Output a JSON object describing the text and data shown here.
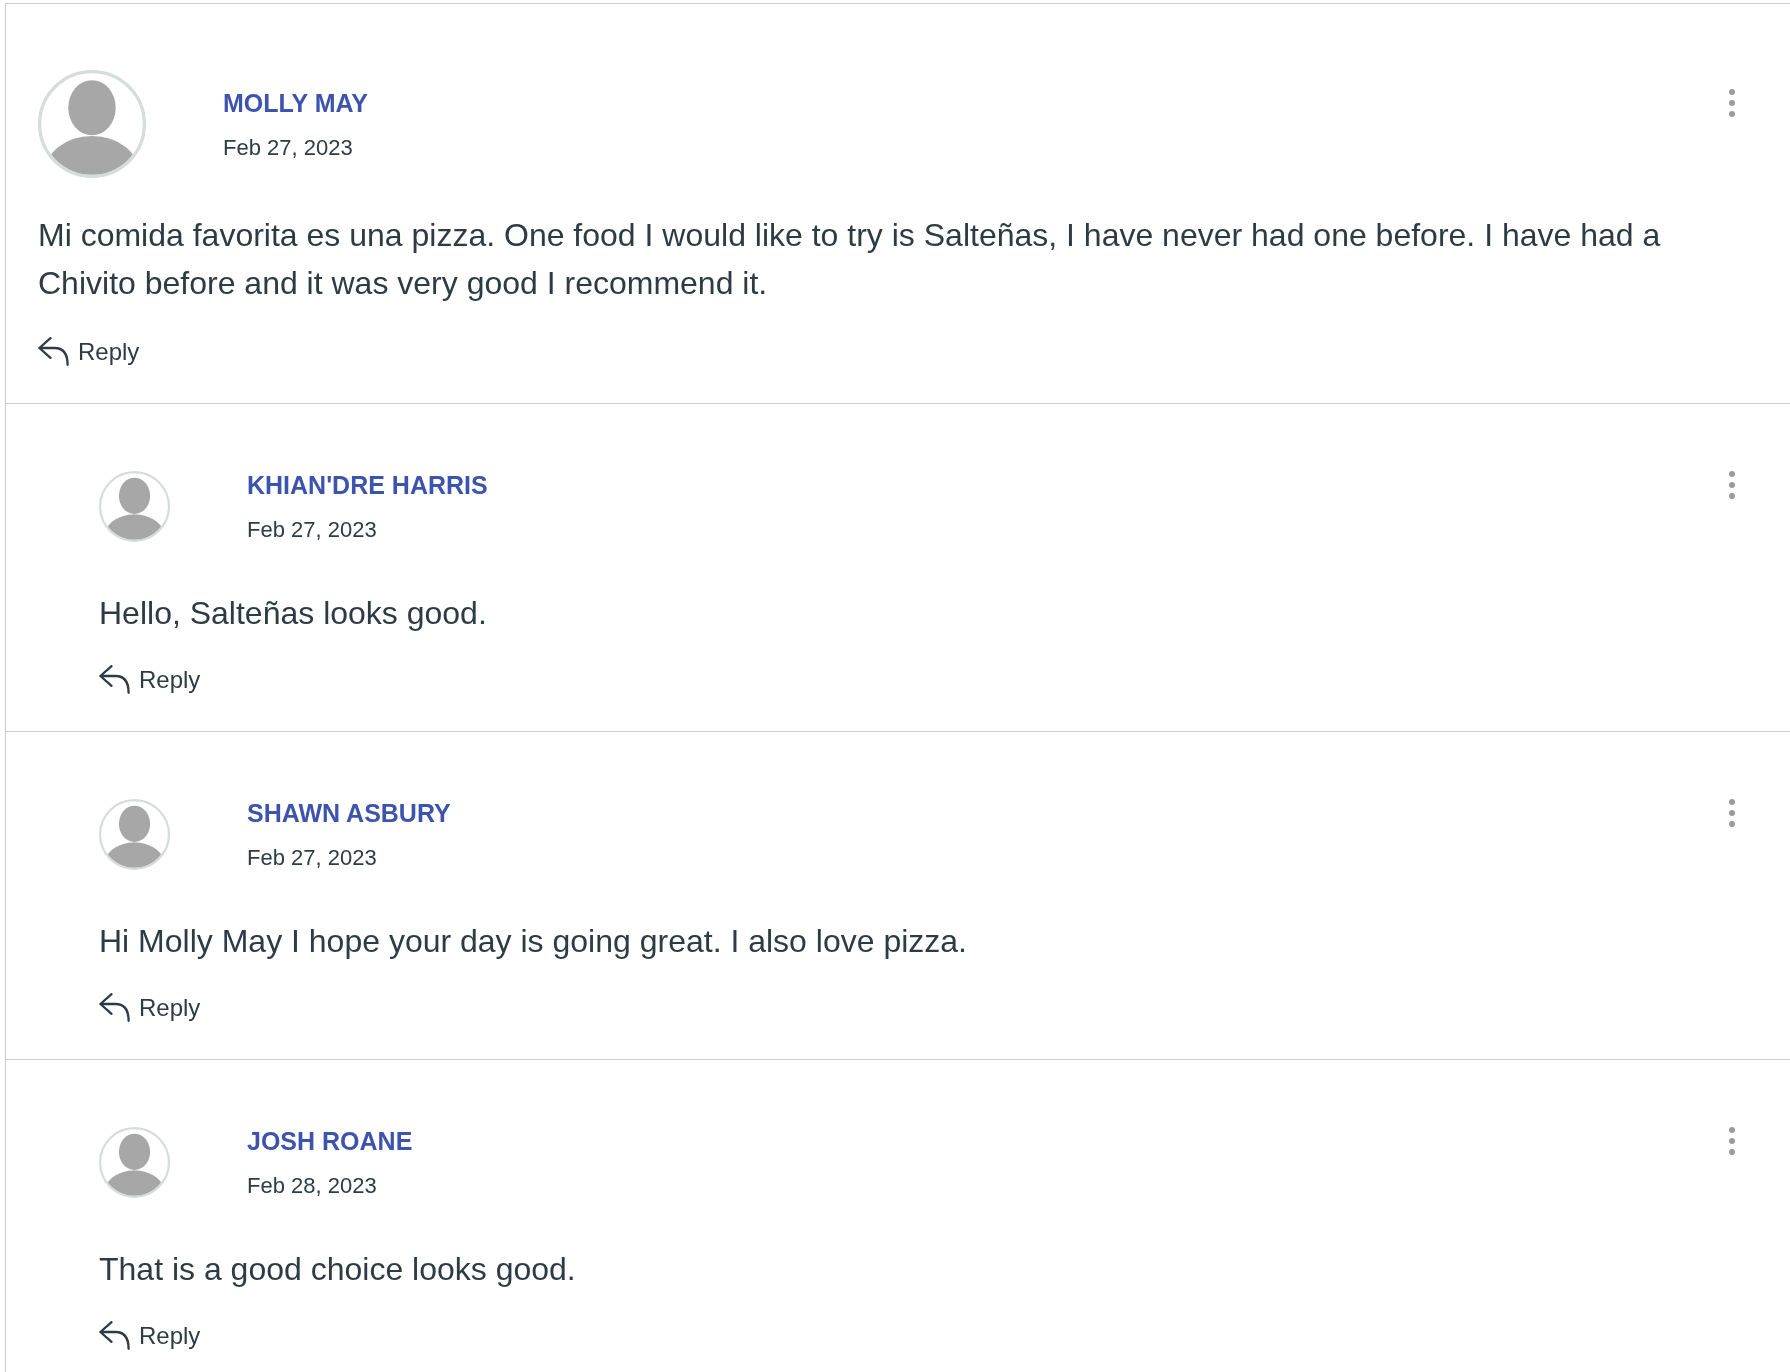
{
  "comments": [
    {
      "author": "MOLLY MAY",
      "date": "Feb 27, 2023",
      "body": "Mi comida favorita es una pizza. One food I would like to try is Salteñas, I have never had one before. I have had a Chivito before and it was very good I recommend it.",
      "reply_label": "Reply",
      "children": [
        {
          "author": "KHIAN'DRE HARRIS",
          "date": "Feb 27, 2023",
          "body": "Hello, Salteñas looks good.",
          "reply_label": "Reply"
        },
        {
          "author": "SHAWN ASBURY",
          "date": "Feb 27, 2023",
          "body": "Hi Molly May I hope your day is going great. I also love pizza.",
          "reply_label": "Reply"
        },
        {
          "author": "JOSH ROANE",
          "date": "Feb 28, 2023",
          "body": "That is a good choice looks good.",
          "reply_label": "Reply"
        }
      ]
    }
  ]
}
